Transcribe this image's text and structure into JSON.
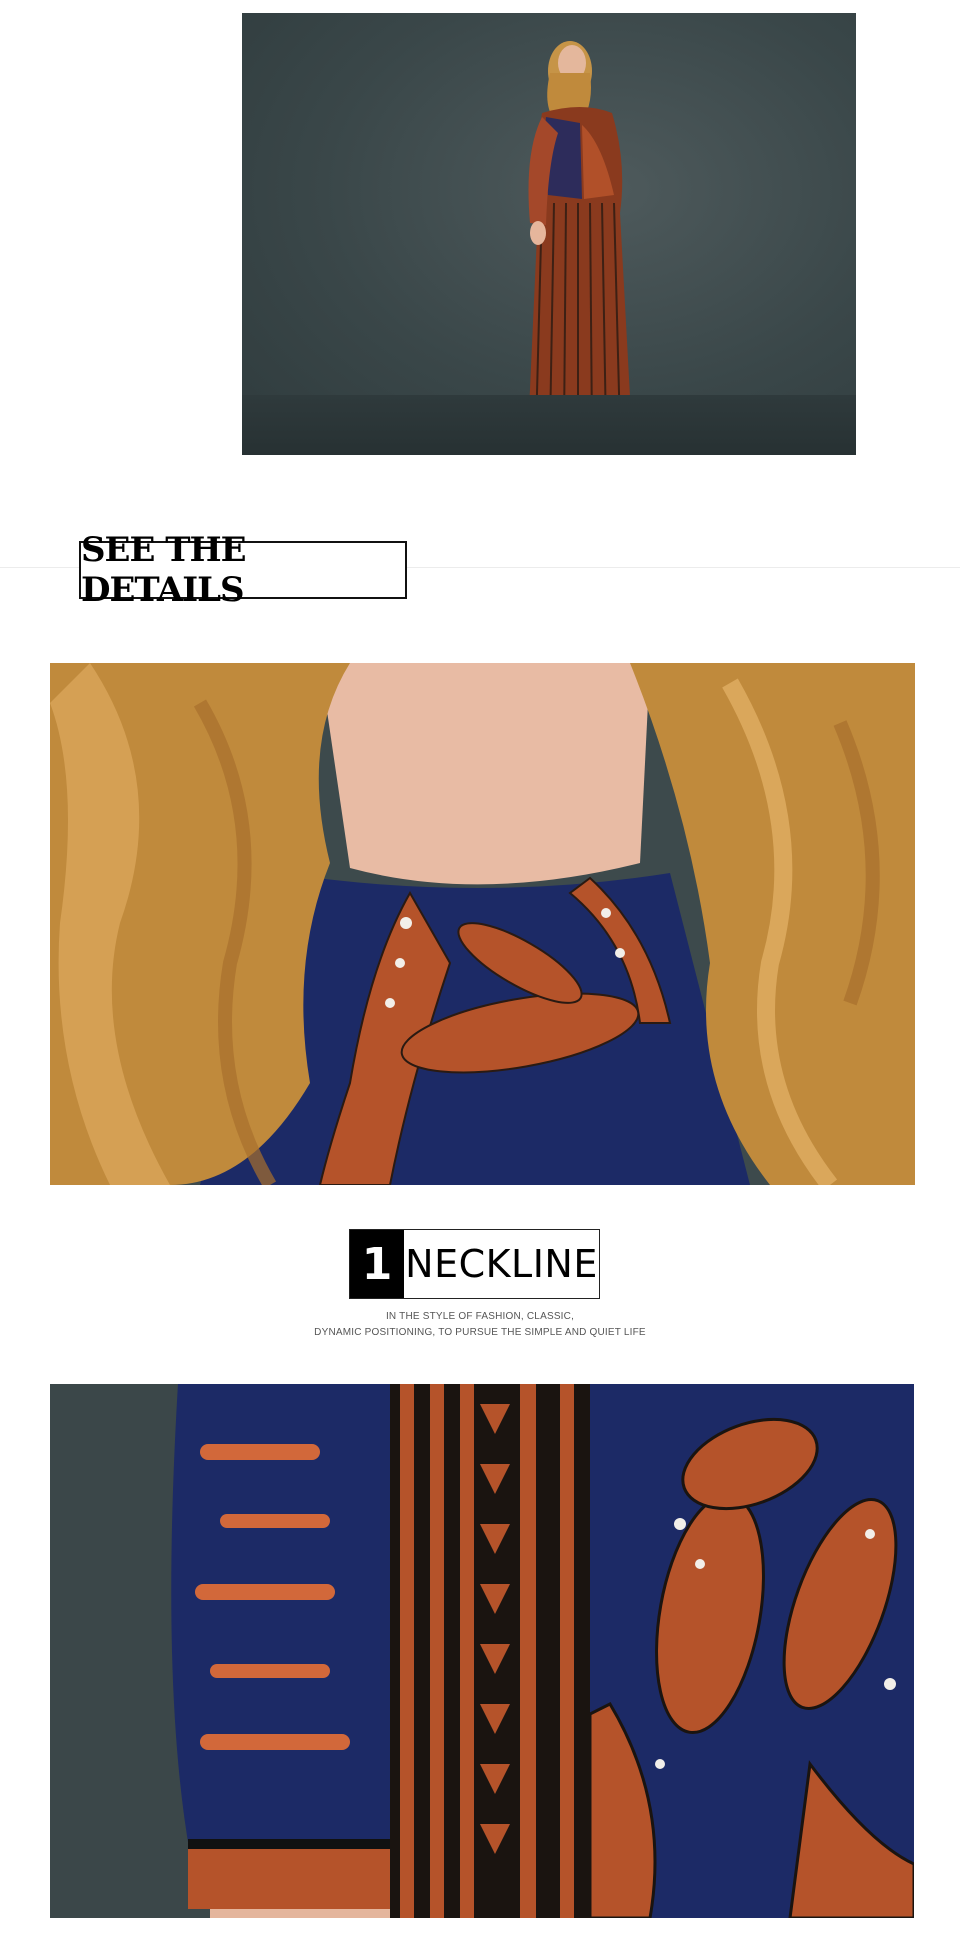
{
  "details_heading": "SEE THE DETAILS",
  "feature": {
    "number": "1",
    "title": "NECKLINE",
    "description_line1": "IN THE STYLE OF FASHION, CLASSIC,",
    "description_line2": "DYNAMIC POSITIONING, TO PURSUE THE SIMPLE AND QUIET LIFE"
  },
  "colors": {
    "backdrop": "#3a4749",
    "dress_rust": "#b5532a",
    "dress_navy": "#1c2a66",
    "hair": "#c48a3e",
    "skin": "#e8b9a2"
  }
}
